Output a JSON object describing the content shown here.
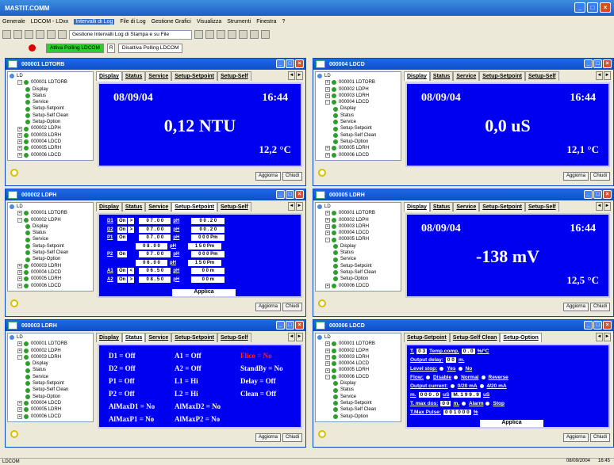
{
  "app": {
    "title": "MASTIT.COMM"
  },
  "menu": [
    {
      "label": "Generale",
      "selected": false
    },
    {
      "label": "LDCOM - LDxx",
      "selected": false
    },
    {
      "label": "Intervalli di Log",
      "selected": true
    },
    {
      "label": "File di Log",
      "selected": false
    },
    {
      "label": "Gestione Grafici",
      "selected": false
    },
    {
      "label": "Visualizza",
      "selected": false
    },
    {
      "label": "Strumenti",
      "selected": false
    },
    {
      "label": "Finestra",
      "selected": false
    },
    {
      "label": "?",
      "selected": false
    }
  ],
  "toolbar": {
    "combo": "Gestione Intervalli Log di Stampa e su File"
  },
  "polling": {
    "on": "Attiva Polling  LDCOM",
    "r": "R",
    "off": "Disattiva Polling  LDCOM"
  },
  "common": {
    "aggiorna": "Aggiorna",
    "chiudi": "Chiudi",
    "applica": "Applica",
    "ld": "LD"
  },
  "windows": [
    {
      "title": "000001 LDTORB",
      "tree": [
        {
          "label": "LD",
          "lvl": 0,
          "pm": ""
        },
        {
          "label": "000001 LDTORB",
          "lvl": 1,
          "pm": "-"
        },
        {
          "label": "Display",
          "lvl": 2,
          "pm": ""
        },
        {
          "label": "Status",
          "lvl": 2,
          "pm": ""
        },
        {
          "label": "Service",
          "lvl": 2,
          "pm": ""
        },
        {
          "label": "Setup-Setpoint",
          "lvl": 2,
          "pm": ""
        },
        {
          "label": "Setup-Self Clean",
          "lvl": 2,
          "pm": ""
        },
        {
          "label": "Setup-Option",
          "lvl": 2,
          "pm": ""
        },
        {
          "label": "000002 LDPH",
          "lvl": 1,
          "pm": "+"
        },
        {
          "label": "000003 LDRH",
          "lvl": 1,
          "pm": "+"
        },
        {
          "label": "000004 LDCD",
          "lvl": 1,
          "pm": "+"
        },
        {
          "label": "000005 LDRH",
          "lvl": 1,
          "pm": "+"
        },
        {
          "label": "000006 LDCD",
          "lvl": 1,
          "pm": "+"
        }
      ],
      "tabs": [
        {
          "label": "Display",
          "active": true
        },
        {
          "label": "Status",
          "active": false
        },
        {
          "label": "Service",
          "active": false
        },
        {
          "label": "Setup-Setpoint",
          "active": false
        },
        {
          "label": "Setup-Self",
          "active": false
        }
      ],
      "display": {
        "date": "08/09/04",
        "time": "16:44",
        "value": "0,12 NTU",
        "temp": "12,2 °C"
      }
    },
    {
      "title": "000004 LDCD",
      "tree": [
        {
          "label": "LD",
          "lvl": 0,
          "pm": ""
        },
        {
          "label": "000001 LDTORB",
          "lvl": 1,
          "pm": "+"
        },
        {
          "label": "000002 LDPH",
          "lvl": 1,
          "pm": "+"
        },
        {
          "label": "000003 LDRH",
          "lvl": 1,
          "pm": "+"
        },
        {
          "label": "000004 LDCD",
          "lvl": 1,
          "pm": "-"
        },
        {
          "label": "Display",
          "lvl": 2,
          "pm": ""
        },
        {
          "label": "Status",
          "lvl": 2,
          "pm": ""
        },
        {
          "label": "Service",
          "lvl": 2,
          "pm": ""
        },
        {
          "label": "Setup-Setpoint",
          "lvl": 2,
          "pm": ""
        },
        {
          "label": "Setup-Self Clean",
          "lvl": 2,
          "pm": ""
        },
        {
          "label": "Setup-Option",
          "lvl": 2,
          "pm": ""
        },
        {
          "label": "000005 LDRH",
          "lvl": 1,
          "pm": "+"
        },
        {
          "label": "000006 LDCD",
          "lvl": 1,
          "pm": "+"
        }
      ],
      "tabs": [
        {
          "label": "Display",
          "active": true
        },
        {
          "label": "Status",
          "active": false
        },
        {
          "label": "Service",
          "active": false
        },
        {
          "label": "Setup-Setpoint",
          "active": false
        },
        {
          "label": "Setup-Self",
          "active": false
        }
      ],
      "display": {
        "date": "08/09/04",
        "time": "16:44",
        "value": "0,0 uS",
        "temp": "12,1 °C"
      }
    },
    {
      "title": "000002 LDPH",
      "tree": [
        {
          "label": "LD",
          "lvl": 0,
          "pm": ""
        },
        {
          "label": "000001 LDTORB",
          "lvl": 1,
          "pm": "+"
        },
        {
          "label": "000002 LDPH",
          "lvl": 1,
          "pm": "-"
        },
        {
          "label": "Display",
          "lvl": 2,
          "pm": ""
        },
        {
          "label": "Status",
          "lvl": 2,
          "pm": ""
        },
        {
          "label": "Service",
          "lvl": 2,
          "pm": ""
        },
        {
          "label": "Setup-Setpoint",
          "lvl": 2,
          "pm": ""
        },
        {
          "label": "Setup-Self Clean",
          "lvl": 2,
          "pm": ""
        },
        {
          "label": "Setup-Option",
          "lvl": 2,
          "pm": ""
        },
        {
          "label": "000003 LDRH",
          "lvl": 1,
          "pm": "+"
        },
        {
          "label": "000004 LDCD",
          "lvl": 1,
          "pm": "+"
        },
        {
          "label": "000005 LDRH",
          "lvl": 1,
          "pm": "+"
        },
        {
          "label": "000006 LDCD",
          "lvl": 1,
          "pm": "+"
        }
      ],
      "tabs": [
        {
          "label": "Display",
          "active": false
        },
        {
          "label": "Status",
          "active": false
        },
        {
          "label": "Service",
          "active": false
        },
        {
          "label": "Setup-Setpoint",
          "active": true
        },
        {
          "label": "Setup-Self",
          "active": false
        }
      ],
      "setpoint": [
        {
          "name": "D1",
          "mode": "On",
          "cmp": ">",
          "v": "0 7 . 0 0",
          "unit": "pH",
          "t": "0 0 . 2 0"
        },
        {
          "name": "D2",
          "mode": "On",
          "cmp": ">",
          "v": "0 7 . 0 0",
          "unit": "pH",
          "t": "0 0 . 2 0"
        },
        {
          "name": "P1",
          "mode": "On",
          "cmp": "",
          "v": "0 7 . 0 0",
          "unit": "pH",
          "t": "0 0 0 Pm"
        },
        {
          "name": "",
          "mode": "",
          "cmp": "",
          "v": "0 8 . 0 0",
          "unit": "pH",
          "t": "1 5 0 Pm"
        },
        {
          "name": "P2",
          "mode": "On",
          "cmp": "",
          "v": "0 7 . 0 0",
          "unit": "pH",
          "t": "0 0 0 Pm"
        },
        {
          "name": "",
          "mode": "",
          "cmp": "",
          "v": "0 6 . 0 0",
          "unit": "pH",
          "t": "1 5 0 Pm"
        },
        {
          "name": "A1",
          "mode": "On",
          "cmp": "<",
          "v": "0 6 . 5 0",
          "unit": "pH",
          "t": "0 0  m"
        },
        {
          "name": "A2",
          "mode": "On",
          "cmp": ">",
          "v": "0 8 . 5 0",
          "unit": "pH",
          "t": "0 0  m"
        }
      ]
    },
    {
      "title": "000005 LDRH",
      "tree": [
        {
          "label": "LD",
          "lvl": 0,
          "pm": ""
        },
        {
          "label": "000001 LDTORB",
          "lvl": 1,
          "pm": "+"
        },
        {
          "label": "000002 LDPH",
          "lvl": 1,
          "pm": "+"
        },
        {
          "label": "000003 LDRH",
          "lvl": 1,
          "pm": "+"
        },
        {
          "label": "000004 LDCD",
          "lvl": 1,
          "pm": "+"
        },
        {
          "label": "000005 LDRH",
          "lvl": 1,
          "pm": "-"
        },
        {
          "label": "Display",
          "lvl": 2,
          "pm": ""
        },
        {
          "label": "Status",
          "lvl": 2,
          "pm": ""
        },
        {
          "label": "Service",
          "lvl": 2,
          "pm": ""
        },
        {
          "label": "Setup-Setpoint",
          "lvl": 2,
          "pm": ""
        },
        {
          "label": "Setup-Self Clean",
          "lvl": 2,
          "pm": ""
        },
        {
          "label": "Setup-Option",
          "lvl": 2,
          "pm": ""
        },
        {
          "label": "000006 LDCD",
          "lvl": 1,
          "pm": "+"
        }
      ],
      "tabs": [
        {
          "label": "Display",
          "active": true
        },
        {
          "label": "Status",
          "active": false
        },
        {
          "label": "Service",
          "active": false
        },
        {
          "label": "Setup-Setpoint",
          "active": false
        },
        {
          "label": "Setup-Self",
          "active": false
        }
      ],
      "display": {
        "date": "08/09/04",
        "time": "16:44",
        "value": "-138 mV",
        "temp": "12,5 °C"
      }
    },
    {
      "title": "000003 LDRH",
      "tree": [
        {
          "label": "LD",
          "lvl": 0,
          "pm": ""
        },
        {
          "label": "000001 LDTORB",
          "lvl": 1,
          "pm": "+"
        },
        {
          "label": "000002 LDPH",
          "lvl": 1,
          "pm": "+"
        },
        {
          "label": "000003 LDRH",
          "lvl": 1,
          "pm": "-"
        },
        {
          "label": "Display",
          "lvl": 2,
          "pm": ""
        },
        {
          "label": "Status",
          "lvl": 2,
          "pm": ""
        },
        {
          "label": "Service",
          "lvl": 2,
          "pm": ""
        },
        {
          "label": "Setup-Setpoint",
          "lvl": 2,
          "pm": ""
        },
        {
          "label": "Setup-Self Clean",
          "lvl": 2,
          "pm": ""
        },
        {
          "label": "Setup-Option",
          "lvl": 2,
          "pm": ""
        },
        {
          "label": "000004 LDCD",
          "lvl": 1,
          "pm": "+"
        },
        {
          "label": "000005 LDRH",
          "lvl": 1,
          "pm": "+"
        },
        {
          "label": "000006 LDCD",
          "lvl": 1,
          "pm": "+"
        }
      ],
      "tabs": [
        {
          "label": "Display",
          "active": false
        },
        {
          "label": "Status",
          "active": true
        },
        {
          "label": "Service",
          "active": false
        },
        {
          "label": "Setup-Setpoint",
          "active": false
        },
        {
          "label": "Setup-Self",
          "active": false
        }
      ],
      "status": [
        [
          "D1 = Off",
          "A1 = Off",
          "Flico = No"
        ],
        [
          "D2 = Off",
          "A2 = Off",
          "StandBy = No"
        ],
        [
          "P1 = Off",
          "L1 = Hi",
          "Delay = Off"
        ],
        [
          "P2 = Off",
          "L2 = Hi",
          "Clean = Off"
        ],
        [
          "AlMaxD1 = No",
          "AlMaxD2 = No",
          ""
        ],
        [
          "AlMaxP1 = No",
          "AlMaxP2 = No",
          ""
        ]
      ]
    },
    {
      "title": "000006 LDCD",
      "tree": [
        {
          "label": "LD",
          "lvl": 0,
          "pm": ""
        },
        {
          "label": "000001 LDTORB",
          "lvl": 1,
          "pm": "+"
        },
        {
          "label": "000002 LDPH",
          "lvl": 1,
          "pm": "+"
        },
        {
          "label": "000003 LDRH",
          "lvl": 1,
          "pm": "+"
        },
        {
          "label": "000004 LDCD",
          "lvl": 1,
          "pm": "+"
        },
        {
          "label": "000005 LDRH",
          "lvl": 1,
          "pm": "+"
        },
        {
          "label": "000006 LDCD",
          "lvl": 1,
          "pm": "-"
        },
        {
          "label": "Display",
          "lvl": 2,
          "pm": ""
        },
        {
          "label": "Status",
          "lvl": 2,
          "pm": ""
        },
        {
          "label": "Service",
          "lvl": 2,
          "pm": ""
        },
        {
          "label": "Setup-Setpoint",
          "lvl": 2,
          "pm": ""
        },
        {
          "label": "Setup-Self Clean",
          "lvl": 2,
          "pm": ""
        },
        {
          "label": "Setup-Option",
          "lvl": 2,
          "pm": ""
        }
      ],
      "tabs": [
        {
          "label": "Setup-Setpoint",
          "active": false
        },
        {
          "label": "Setup-Self Clean",
          "active": false
        },
        {
          "label": "Setup-Option",
          "active": true
        }
      ],
      "option": [
        {
          "label": "T.",
          "val": "0 3",
          "extra": "Temp.comp.",
          "val2": "0 . 0",
          "unit": "%/°C"
        },
        {
          "label": "Output delay:",
          "val": "0 0",
          "extra": "",
          "val2": "",
          "unit": "m."
        },
        {
          "label": "Level stop:",
          "val": "",
          "extra": "Yes",
          "val2": "No",
          "unit": ""
        },
        {
          "label": "Flow:",
          "val": "",
          "extra": "Disable",
          "val2": "Normal",
          "unit": "Reverse"
        },
        {
          "label": "Output current:",
          "val": "",
          "extra": "0/20 mA",
          "val2": "4/20 mA",
          "unit": ""
        },
        {
          "label": "m.",
          "val": "0 0 0 . 0",
          "extra": "uS",
          "val2": "M. 1 9 9 . 9",
          "unit": "uS"
        },
        {
          "label": "T. max dos:",
          "val": "0 0",
          "extra": "m.",
          "val2": "Alarm",
          "unit": "Stop"
        },
        {
          "label": "T.Max Pulse:",
          "val": "0 0 1 0 0 0",
          "extra": "",
          "val2": "",
          "unit": "%"
        }
      ]
    }
  ],
  "statusbar": {
    "left": "LDCOM",
    "time": "08/09/2004",
    "clock": "16:45"
  }
}
